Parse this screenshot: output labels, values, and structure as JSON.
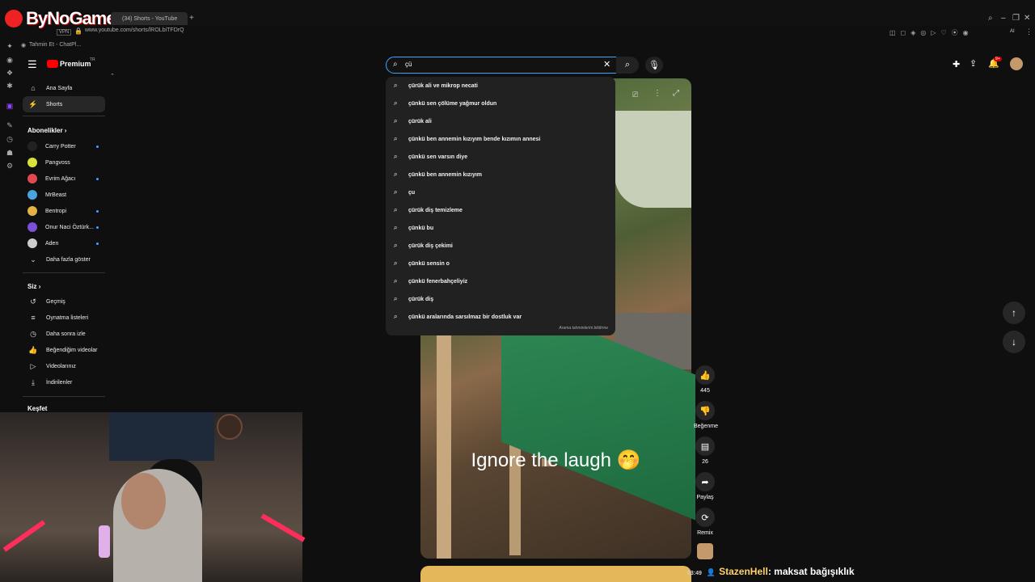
{
  "overlay": {
    "brand": "ByNoGame"
  },
  "browser": {
    "tab_title": "(34) Shorts - YouTube",
    "vpn_badge": "VPN",
    "url": "www.youtube.com/shorts/lROLbiTFDrQ",
    "bookmark": "Tahmin Et - ChatPl...",
    "ai_label": "AI"
  },
  "youtube": {
    "premium_label": "Premium",
    "premium_region": "TR",
    "notif_count": "9+",
    "nav": [
      {
        "label": "Ana Sayfa",
        "icon": "home-icon"
      },
      {
        "label": "Shorts",
        "icon": "shorts-icon",
        "active": true
      }
    ],
    "subscriptions_title": "Abonelikler",
    "subscriptions": [
      {
        "label": "Carry Potter",
        "color": "#222222",
        "new": true
      },
      {
        "label": "Pangvoss",
        "color": "#d8e23a",
        "new": false
      },
      {
        "label": "Evrim Ağacı",
        "color": "#e0494f",
        "new": true
      },
      {
        "label": "MrBeast",
        "color": "#49a3e0",
        "new": false
      },
      {
        "label": "Bentropi",
        "color": "#e3b246",
        "new": true
      },
      {
        "label": "Onur Naci Öztürk...",
        "color": "#7b4fd6",
        "new": true
      },
      {
        "label": "Aden",
        "color": "#cccccc",
        "new": true
      }
    ],
    "show_more": "Daha fazla göster",
    "you_title": "Siz",
    "you_items": [
      {
        "label": "Geçmiş",
        "icon": "history-icon"
      },
      {
        "label": "Oynatma listeleri",
        "icon": "playlist-icon"
      },
      {
        "label": "Daha sonra izle",
        "icon": "watch-later-icon"
      },
      {
        "label": "Beğendiğim videolar",
        "icon": "liked-icon"
      },
      {
        "label": "Videolarınız",
        "icon": "your-videos-icon"
      },
      {
        "label": "İndirilenler",
        "icon": "downloads-icon"
      }
    ],
    "explore_title": "Keşfet",
    "search": {
      "value": "çü",
      "suggestions": [
        "çürük ali ve mikrop necati",
        "çünkü sen çölüme yağmur oldun",
        "çürük ali",
        "çünkü ben annemin kızıyım bende kızımın annesi",
        "çünkü sen varsın diye",
        "çünkü ben annemin kızıyım",
        "çu",
        "çürük diş temizleme",
        "çünkü bu",
        "çürük diş çekimi",
        "çünkü sensin o",
        "çünkü fenerbahçeliyiz",
        "çürük diş",
        "çünkü aralarında sarsılmaz bir dostluk var"
      ],
      "report_label": "Arama tahminlerini bildirme"
    },
    "short": {
      "caption": "Ignore the laugh 🤭",
      "like_count": "445",
      "dislike_label": "Beğenme",
      "comment_count": "26",
      "share_label": "Paylaş",
      "remix_label": "Remix"
    }
  },
  "chat": {
    "time": "03:49",
    "user": "StazenHell",
    "message": ": maksat bağışıklık"
  }
}
